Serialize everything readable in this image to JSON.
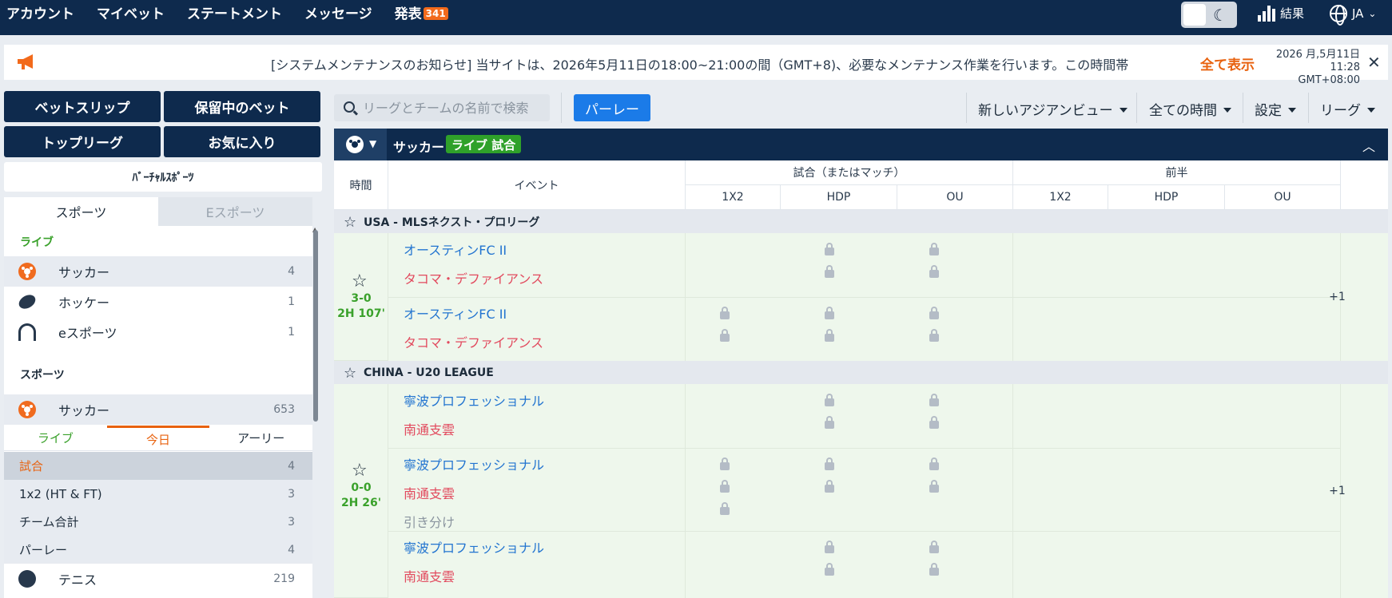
{
  "topnav": {
    "items": [
      "アカウント",
      "マイベット",
      "ステートメント",
      "メッセージ",
      "発表"
    ],
    "announcement_count": "341",
    "results_label": "結果",
    "language": "JA"
  },
  "announcement": {
    "text": "[システムメンテナンスのお知らせ] 当サイトは、2026年5月11日の18:00~21:00の間（GMT+8)、必要なメンテナンス作業を行います。この時間帯",
    "show_all": "全て表示",
    "date": "2026 月,5月11日",
    "time": "11:28 GMT+08:00"
  },
  "sidebar": {
    "buttons": [
      "ベットスリップ",
      "保留中のベット",
      "トップリーグ",
      "お気に入り"
    ],
    "virtual_sports": "ﾊﾞｰﾁｬﾙｽﾎﾟｰﾂ",
    "tabs": [
      "スポーツ",
      "Eスポーツ"
    ],
    "live_label": "ライブ",
    "live_sports": [
      {
        "name": "サッカー",
        "count": "4",
        "icon": "soccer-ball-icon"
      },
      {
        "name": "ホッケー",
        "count": "1",
        "icon": "hockey-puck-icon"
      },
      {
        "name": "eスポーツ",
        "count": "1",
        "icon": "headset-icon"
      }
    ],
    "sports_label": "スポーツ",
    "soccer": {
      "name": "サッカー",
      "count": "653"
    },
    "period_tabs": [
      "ライブ",
      "今日",
      "アーリー"
    ],
    "markets": [
      {
        "name": "試合",
        "count": "4"
      },
      {
        "name": "1x2 (HT & FT)",
        "count": "3"
      },
      {
        "name": "チーム合計",
        "count": "3"
      },
      {
        "name": "パーレー",
        "count": "4"
      }
    ],
    "tennis": {
      "name": "テニス",
      "count": "219"
    }
  },
  "toolbar": {
    "search_placeholder": "リーグとチームの名前で検索",
    "parlay": "パーレー",
    "view": "新しいアジアンビュー",
    "time_filter": "全ての時間",
    "settings": "設定",
    "league": "リーグ"
  },
  "section": {
    "sport": "サッカー",
    "live_badge": "ライブ 試合"
  },
  "table": {
    "col_time": "時間",
    "col_event": "イベント",
    "group_match": "試合（またはマッチ）",
    "group_half": "前半",
    "sub_cols": [
      "1X2",
      "HDP",
      "OU",
      "1X2",
      "HDP",
      "OU"
    ]
  },
  "leagues": [
    {
      "name": "USA - MLSネクスト・プロリーグ",
      "score": "3-0",
      "clock": "2H 107'",
      "more": "+1",
      "home": "オースティンFC II",
      "away": "タコマ・デファイアンス"
    },
    {
      "name": "CHINA - U20 LEAGUE",
      "score": "0-0",
      "clock": "2H 26'",
      "more": "+1",
      "home": "寧波プロフェッショナル",
      "away": "南通支雲",
      "draw": "引き分け"
    }
  ]
}
